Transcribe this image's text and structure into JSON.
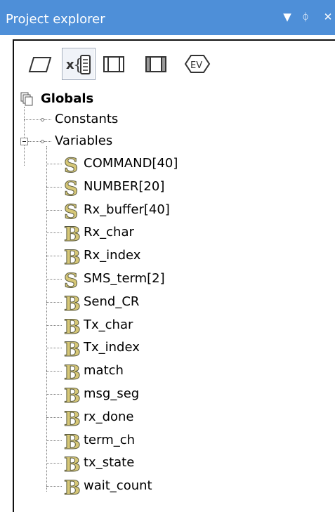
{
  "panel": {
    "title": "Project explorer",
    "menu_icon": "▼",
    "pin_icon": "ᛰ",
    "close_icon": "✕"
  },
  "toolbar": {
    "tools": [
      {
        "icon": "parallelogram-flow-icon",
        "active": false
      },
      {
        "icon": "variables-icon",
        "active": true
      },
      {
        "icon": "macro-icon",
        "active": false
      },
      {
        "icon": "component-icon",
        "active": false
      },
      {
        "icon": "event-icon",
        "text": "EV",
        "active": false
      }
    ]
  },
  "tree": {
    "root_label": "Globals",
    "constants_label": "Constants",
    "variables_label": "Variables",
    "variables": [
      {
        "name": "COMMAND[40]",
        "type": "S"
      },
      {
        "name": "NUMBER[20]",
        "type": "S"
      },
      {
        "name": "Rx_buffer[40]",
        "type": "S"
      },
      {
        "name": "Rx_char",
        "type": "B"
      },
      {
        "name": "Rx_index",
        "type": "B"
      },
      {
        "name": "SMS_term[2]",
        "type": "S"
      },
      {
        "name": "Send_CR",
        "type": "B"
      },
      {
        "name": "Tx_char",
        "type": "B"
      },
      {
        "name": "Tx_index",
        "type": "B"
      },
      {
        "name": "match",
        "type": "B"
      },
      {
        "name": "msg_seg",
        "type": "B"
      },
      {
        "name": "rx_done",
        "type": "B"
      },
      {
        "name": "term_ch",
        "type": "B"
      },
      {
        "name": "tx_state",
        "type": "B"
      },
      {
        "name": "wait_count",
        "type": "B"
      }
    ]
  },
  "colors": {
    "titlebar": "#4e8fd8",
    "glyph_fill": "#d6c777",
    "glyph_stroke": "#5a5a40"
  }
}
